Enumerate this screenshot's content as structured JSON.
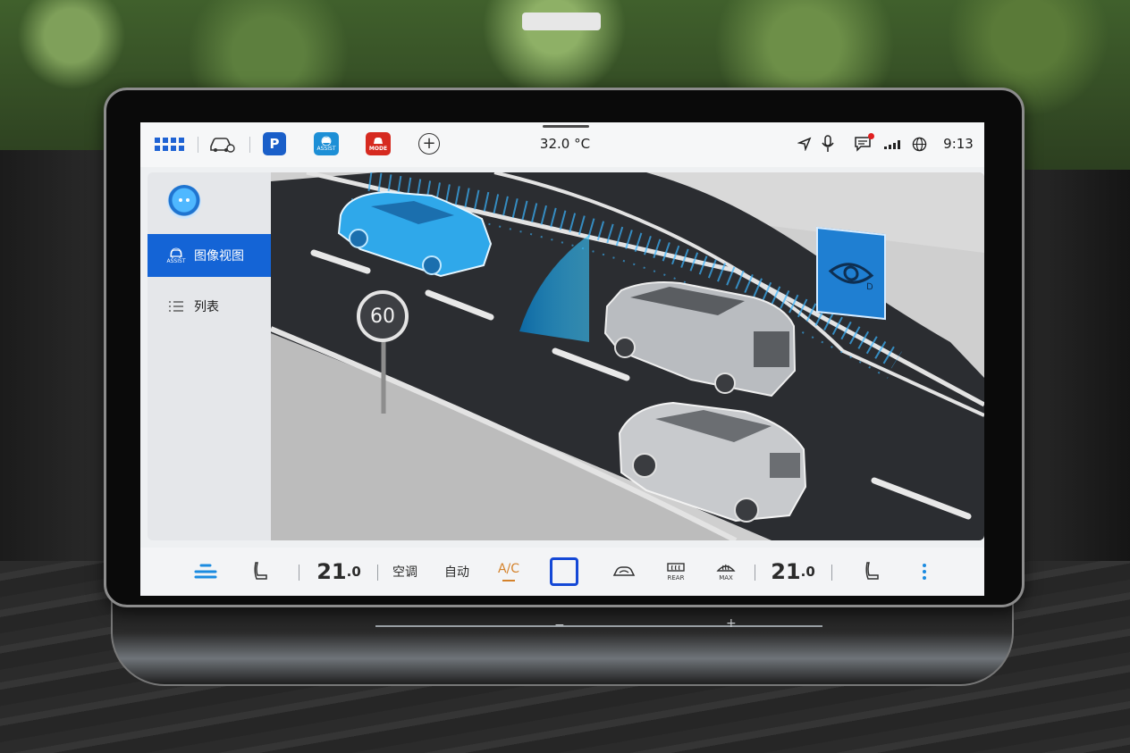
{
  "status_bar": {
    "park_label": "P",
    "assist_label": "ASSIST",
    "mode_label": "MODE",
    "outside_temperature": "32.0 °C",
    "time": "9:13"
  },
  "side_menu": {
    "items": [
      {
        "label": "图像视图",
        "sub_label": "ASSIST",
        "active": true
      },
      {
        "label": "列表",
        "active": false
      }
    ]
  },
  "assist_view": {
    "speed_limit": "60",
    "colors": {
      "ego_vehicle": "#2fa8ea",
      "accent": "#1464d6"
    }
  },
  "climate_bar": {
    "driver_temp_whole": "21",
    "driver_temp_decimal": ".0",
    "passenger_temp_whole": "21",
    "passenger_temp_decimal": ".0",
    "climate_label": "空调",
    "auto_label": "自动",
    "ac_label": "A/C",
    "rear_defrost_label": "REAR",
    "max_defrost_label": "MAX"
  }
}
